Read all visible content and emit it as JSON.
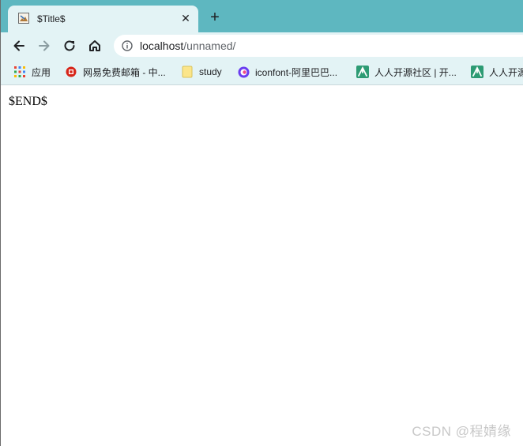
{
  "tab": {
    "title": "$Title$",
    "close_glyph": "✕",
    "favicon": "page-image-icon"
  },
  "new_tab_glyph": "+",
  "toolbar": {
    "back_icon": "back-arrow-icon",
    "forward_icon": "forward-arrow-icon",
    "reload_icon": "reload-icon",
    "home_icon": "home-icon",
    "url_host": "localhost",
    "url_path": "/unnamed/"
  },
  "bookmarks": [
    {
      "label": "应用",
      "icon": "apps-grid-icon"
    },
    {
      "label": "网易免费邮箱 - 中...",
      "icon": "netease-mail-icon"
    },
    {
      "label": "study",
      "icon": "folder-icon"
    },
    {
      "label": "iconfont-阿里巴巴...",
      "icon": "iconfont-icon"
    },
    {
      "label": "人人开源社区 | 开...",
      "icon": "renren-icon"
    },
    {
      "label": "人人开源",
      "icon": "renren-icon"
    }
  ],
  "page": {
    "body_text": "$END$"
  },
  "watermark": "CSDN @程婧缘",
  "colors": {
    "tabstrip": "#5eb7c0",
    "toolbar": "#e3f3f5"
  }
}
